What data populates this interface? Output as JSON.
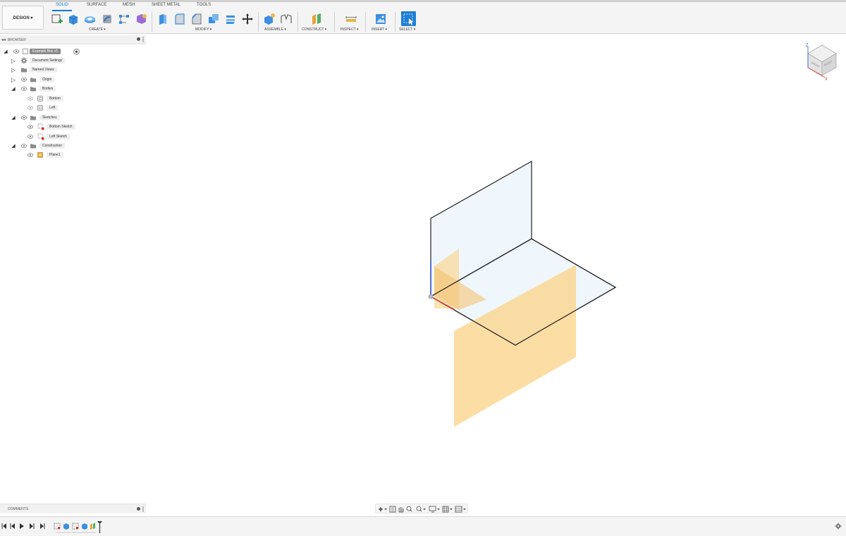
{
  "workspace": {
    "label": "DESIGN ▾"
  },
  "tabs": [
    {
      "label": "SOLID"
    },
    {
      "label": "SURFACE"
    },
    {
      "label": "MESH"
    },
    {
      "label": "SHEET METAL"
    },
    {
      "label": "TOOLS"
    }
  ],
  "groups": {
    "create": "CREATE ▾",
    "modify": "MODIFY ▾",
    "assemble": "ASSEMBLE ▾",
    "construct": "CONSTRUCT ▾",
    "inspect": "INSPECT ▾",
    "insert": "INSERT ▾",
    "select": "SELECT ▾"
  },
  "browser": {
    "title": "BROWSER",
    "document": "Example Box v1",
    "items": [
      {
        "label": "Document Settings"
      },
      {
        "label": "Named Views"
      },
      {
        "label": "Origin"
      },
      {
        "label": "Bodies"
      },
      {
        "label": "Bottom"
      },
      {
        "label": "Left"
      },
      {
        "label": "Sketches"
      },
      {
        "label": "Bottom Sketch"
      },
      {
        "label": "Left Sketch"
      },
      {
        "label": "Construction"
      },
      {
        "label": "Plane1"
      }
    ]
  },
  "comments": {
    "title": "COMMENTS"
  },
  "viewcube": {
    "z_label": "Z",
    "x_label": "X",
    "front_label": "FRONT",
    "right_label": "RIGHT"
  },
  "colors": {
    "accent": "#0a7ad6",
    "plane": "#fbd48c",
    "sketch_plane": "#e9f4fb",
    "axis_x": "#d9342b",
    "axis_z": "#2f4fd8"
  },
  "icons": {
    "tree_expand": "▷",
    "tree_collapse": "◢",
    "visibility": "eye-icon"
  }
}
